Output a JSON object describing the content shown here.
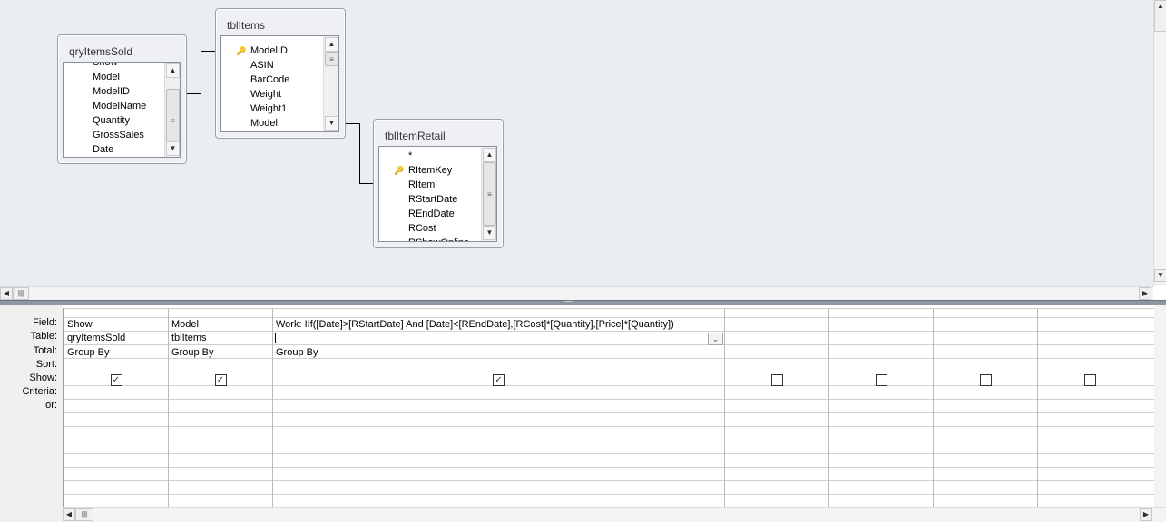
{
  "tables": [
    {
      "name": "qryItemsSold",
      "fields": [
        {
          "label": "Show"
        },
        {
          "label": "Model"
        },
        {
          "label": "ModelID"
        },
        {
          "label": "ModelName"
        },
        {
          "label": "Quantity"
        },
        {
          "label": "GrossSales"
        },
        {
          "label": "Date"
        }
      ]
    },
    {
      "name": "tblItems",
      "fields": [
        {
          "label": "ModelID",
          "key": true
        },
        {
          "label": "ASIN"
        },
        {
          "label": "BarCode"
        },
        {
          "label": "Weight"
        },
        {
          "label": "Weight1"
        },
        {
          "label": "Model"
        }
      ]
    },
    {
      "name": "tblItemRetail",
      "fields": [
        {
          "label": "*"
        },
        {
          "label": "RItemKey",
          "key": true
        },
        {
          "label": "RItem"
        },
        {
          "label": "RStartDate"
        },
        {
          "label": "REndDate"
        },
        {
          "label": "RCost"
        },
        {
          "label": "RShowOnline"
        }
      ]
    }
  ],
  "grid": {
    "row_labels": [
      "Field:",
      "Table:",
      "Total:",
      "Sort:",
      "Show:",
      "Criteria:",
      "or:"
    ],
    "columns": [
      {
        "field": "Show",
        "table": "qryItemsSold",
        "total": "Group By",
        "sort": "",
        "show": true
      },
      {
        "field": "Model",
        "table": "tblItems",
        "total": "Group By",
        "sort": "",
        "show": true
      },
      {
        "field": "Work: IIf([Date]>[RStartDate] And [Date]<[REndDate],[RCost]*[Quantity],[Price]*[Quantity])",
        "table": "",
        "total": "Group By",
        "sort": "",
        "show": true
      },
      {
        "field": "",
        "table": "",
        "total": "",
        "sort": "",
        "show": false
      },
      {
        "field": "",
        "table": "",
        "total": "",
        "sort": "",
        "show": false
      },
      {
        "field": "",
        "table": "",
        "total": "",
        "sort": "",
        "show": false
      },
      {
        "field": "",
        "table": "",
        "total": "",
        "sort": "",
        "show": false
      }
    ]
  }
}
